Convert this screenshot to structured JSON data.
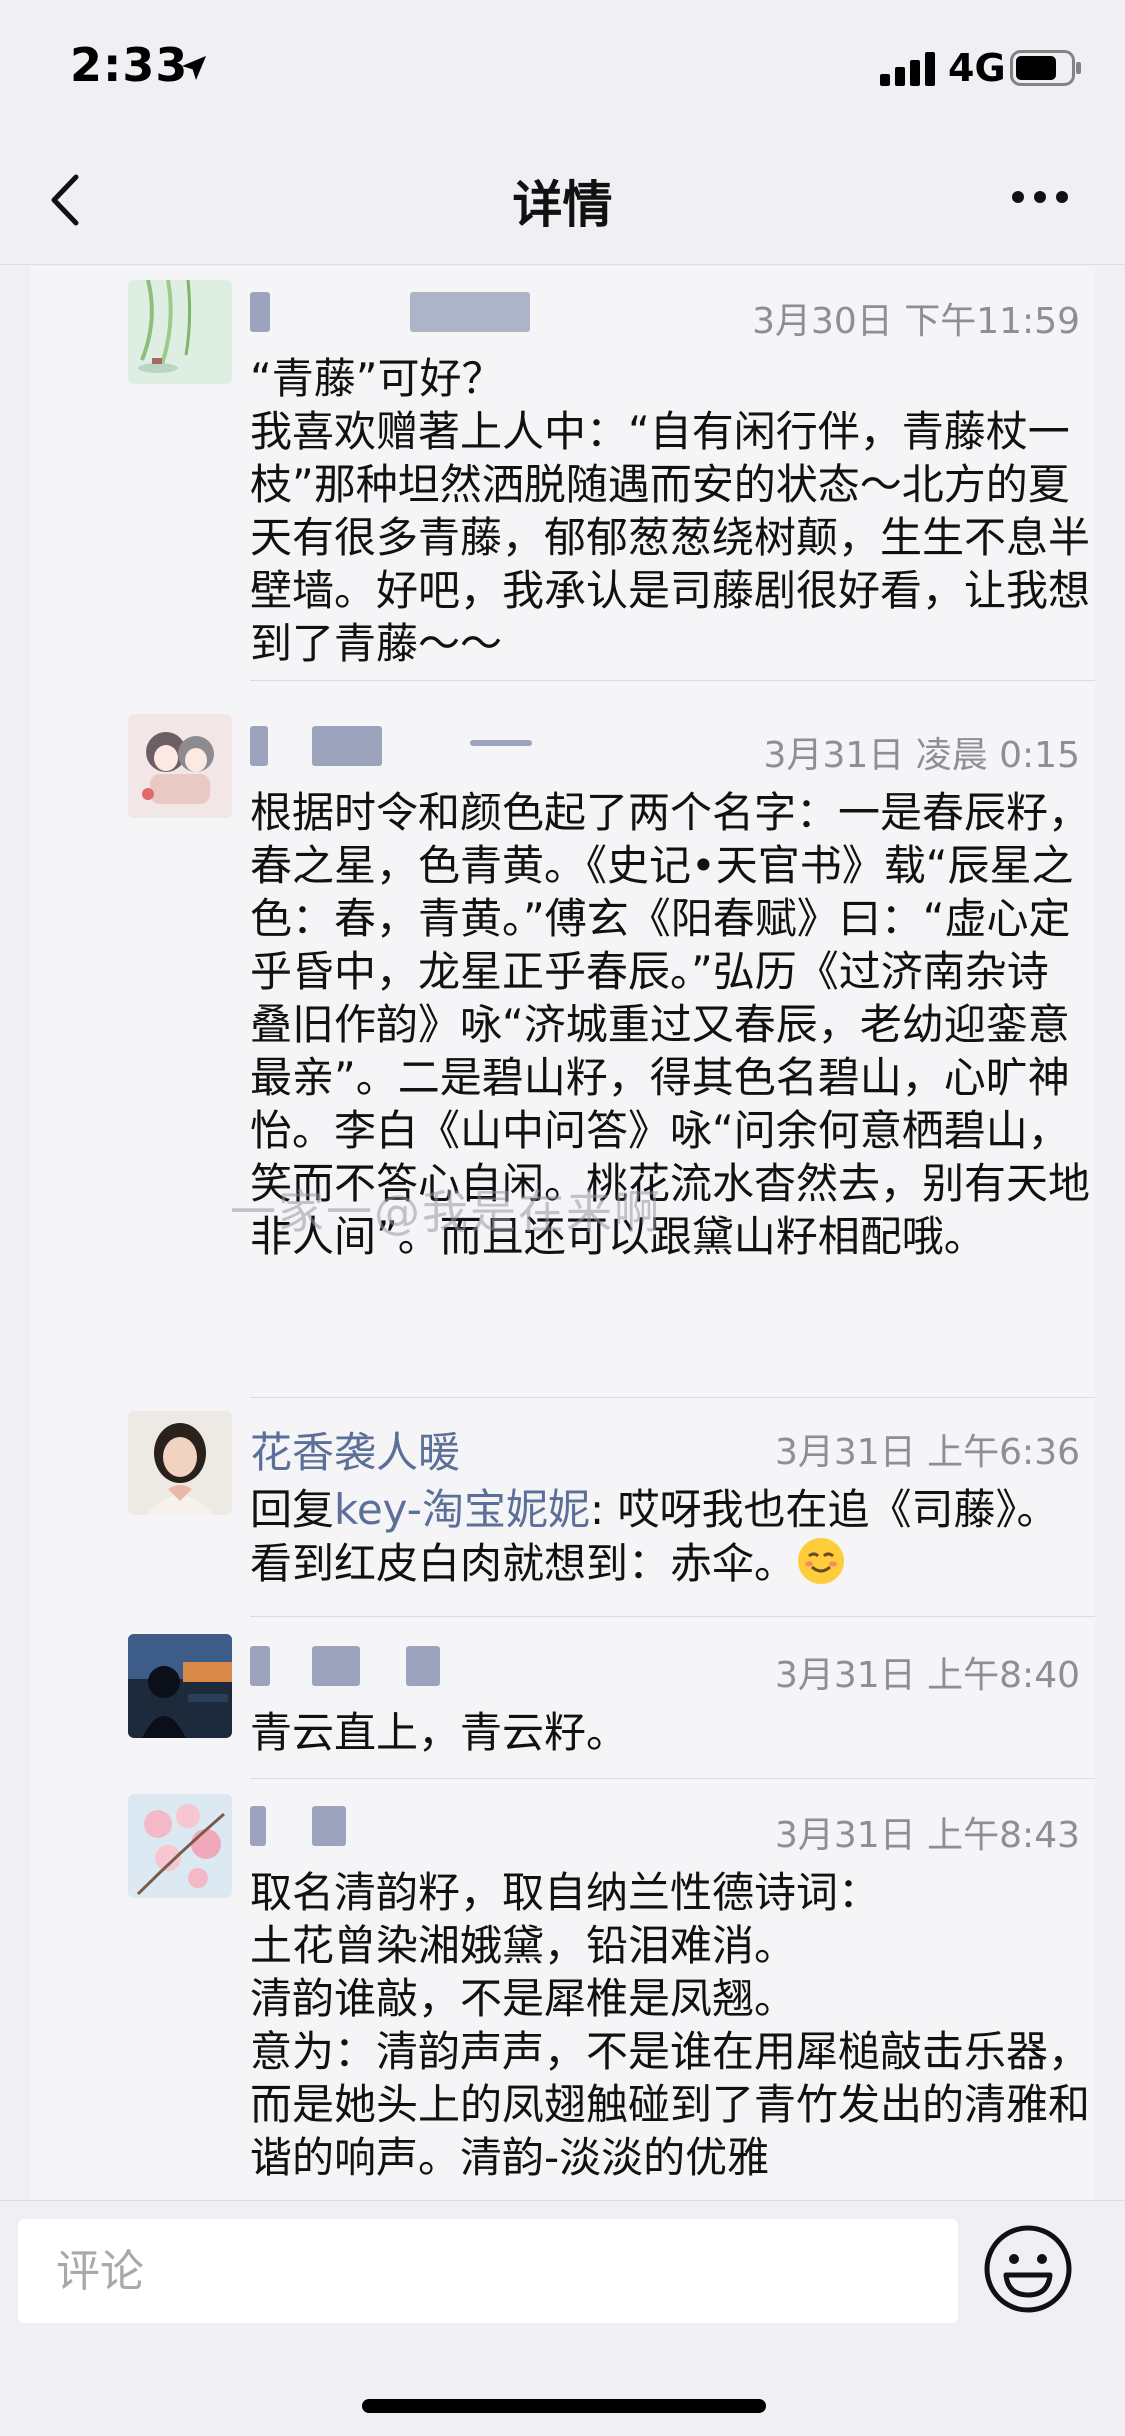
{
  "status_bar": {
    "time": "2:33",
    "network": "4G"
  },
  "nav": {
    "title": "详情"
  },
  "comments": [
    {
      "timestamp": "3月30日 下午11:59",
      "text": "“青藤”可好？\n我喜欢赠著上人中：“自有闲行伴，青藤杖一枝”那种坦然洒脱随遇而安的状态～北方的夏天有很多青藤，郁郁葱葱绕树颠，生生不息半壁墙。好吧，我承认是司藤剧很好看，让我想到了青藤～～"
    },
    {
      "timestamp": "3月31日 凌晨 0:15",
      "text": "根据时令和颜色起了两个名字：一是春辰籽，春之星，色青黄。《史记•天官书》载“辰星之色：春，青黄。”傅玄《阳春赋》曰：“虚心定乎昏中，龙星正乎春辰。”弘历《过济南杂诗叠旧作韵》咏“济城重过又春辰，老幼迎銮意最亲”。二是碧山籽，得其色名碧山，心旷神怡。李白《山中问答》咏“问余何意栖碧山，笑而不答心自闲。桃花流水杳然去，别有天地非人间”。而且还可以跟黛山籽相配哦。"
    },
    {
      "name": "花香袭人暖",
      "timestamp": "3月31日 上午6:36",
      "reply_prefix": "回复",
      "reply_to": "key-淘宝妮妮",
      "text": ": 哎呀我也在追《司藤》。看到红皮白肉就想到：赤伞。"
    },
    {
      "timestamp": "3月31日 上午8:40",
      "text": "青云直上，青云籽。"
    },
    {
      "timestamp": "3月31日 上午8:43",
      "text": "取名清韵籽，取自纳兰性德诗词：\n土花曾染湘娥黛，铅泪难消。\n清韵谁敲，不是犀椎是凤翘。\n意为：清韵声声，不是谁在用犀槌敲击乐器，而是她头上的凤翅触碰到了青竹发出的清雅和谐的响声。清韵-淡淡的优雅"
    }
  ],
  "watermark": "一家一@我是在来啊",
  "comment_input": {
    "placeholder": "评论"
  },
  "colors": {
    "link": "#5c6f99",
    "background": "#efeff4",
    "card": "#f5f5f7"
  },
  "icons": [
    "location-arrow-icon",
    "signal-icon",
    "battery-icon",
    "back-chevron-icon",
    "more-dots-icon",
    "smiley-emoji-icon"
  ]
}
